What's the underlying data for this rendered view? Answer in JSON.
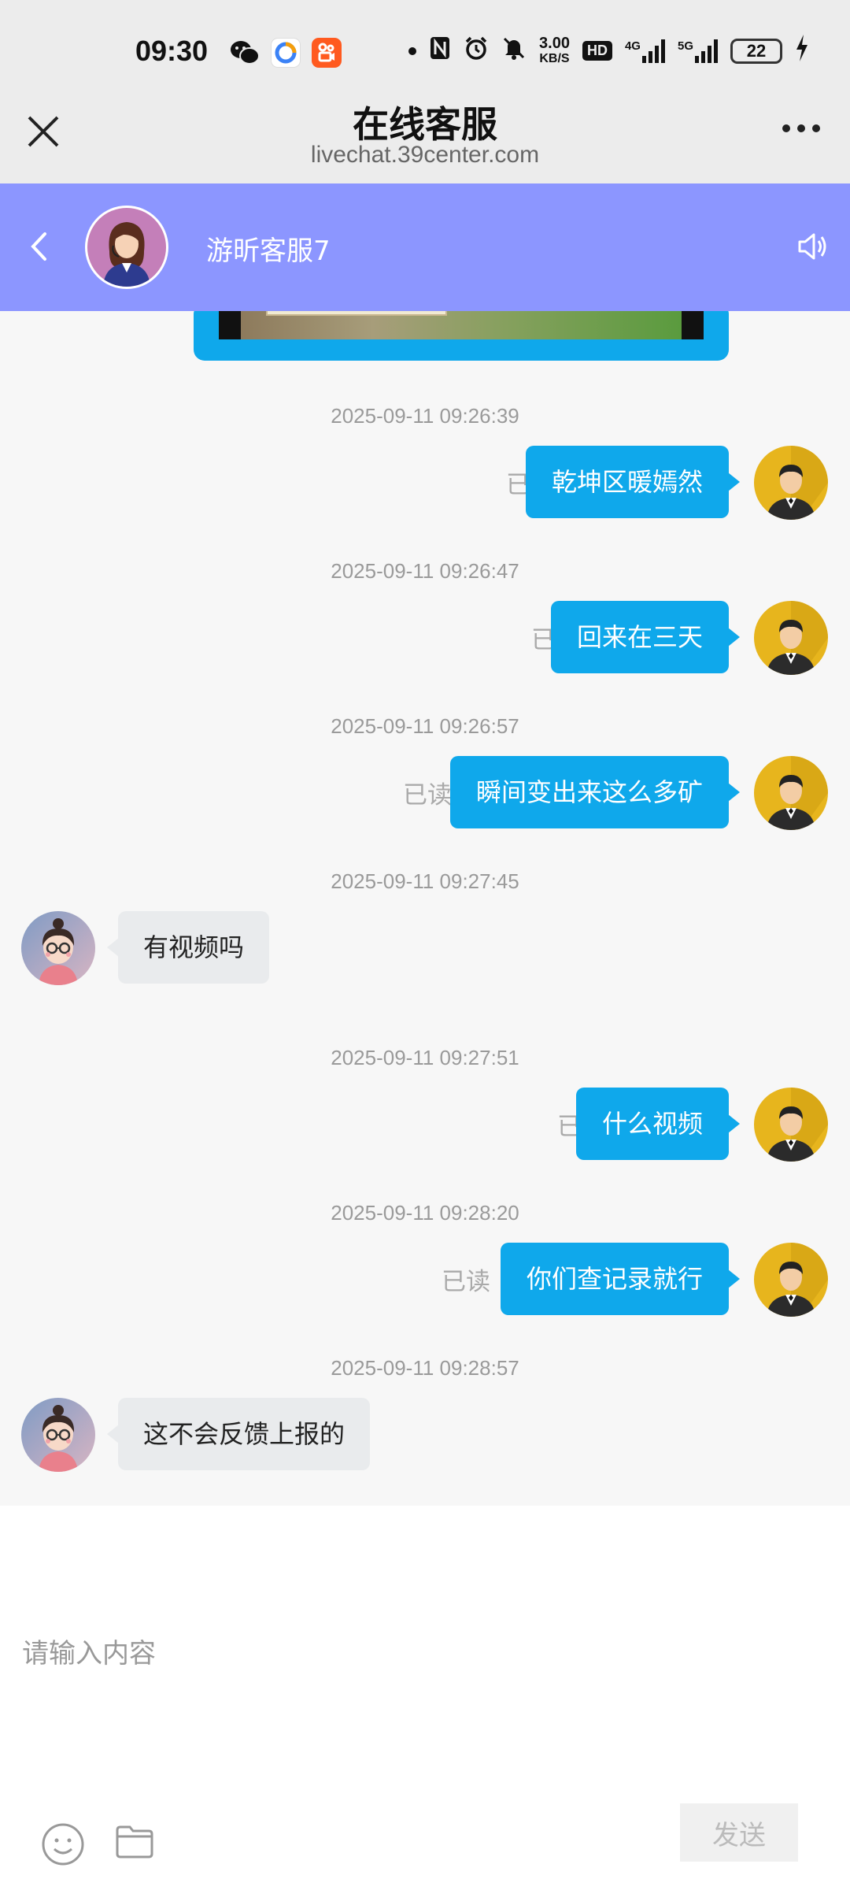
{
  "status_bar": {
    "time": "09:30",
    "apps": [
      "wechat-icon",
      "browser-icon",
      "kuaishou-icon"
    ],
    "net_speed_value": "3.00",
    "net_speed_unit": "KB/S",
    "hd_badge": "HD",
    "signal_4g": "4G",
    "signal_5g": "5G",
    "battery": "22"
  },
  "browser": {
    "title": "在线客服",
    "url": "livechat.39center.com"
  },
  "chat_header": {
    "agent_name": "游昕客服7",
    "color": "#8c96ff"
  },
  "messages": [
    {
      "timestamp": "2025-09-11 09:26:39",
      "from": "me",
      "text": "乾坤区暖嫣然",
      "status": "已读"
    },
    {
      "timestamp": "2025-09-11 09:26:47",
      "from": "me",
      "text": "回来在三天",
      "status": "已读"
    },
    {
      "timestamp": "2025-09-11 09:26:57",
      "from": "me",
      "text": "瞬间变出来这么多矿",
      "status": "已读"
    },
    {
      "timestamp": "2025-09-11 09:27:45",
      "from": "agent",
      "text": "有视频吗"
    },
    {
      "timestamp": "2025-09-11 09:27:51",
      "from": "me",
      "text": "什么视频",
      "status": "已读"
    },
    {
      "timestamp": "2025-09-11 09:28:20",
      "from": "me",
      "text": "你们查记录就行",
      "status": "已读"
    },
    {
      "timestamp": "2025-09-11 09:28:57",
      "from": "agent",
      "text": "这不会反馈上报的"
    }
  ],
  "composer": {
    "placeholder": "请输入内容",
    "send_label": "发送"
  },
  "colors": {
    "my_bubble": "#0fa8eb",
    "agent_bubble": "#e9ebed"
  }
}
